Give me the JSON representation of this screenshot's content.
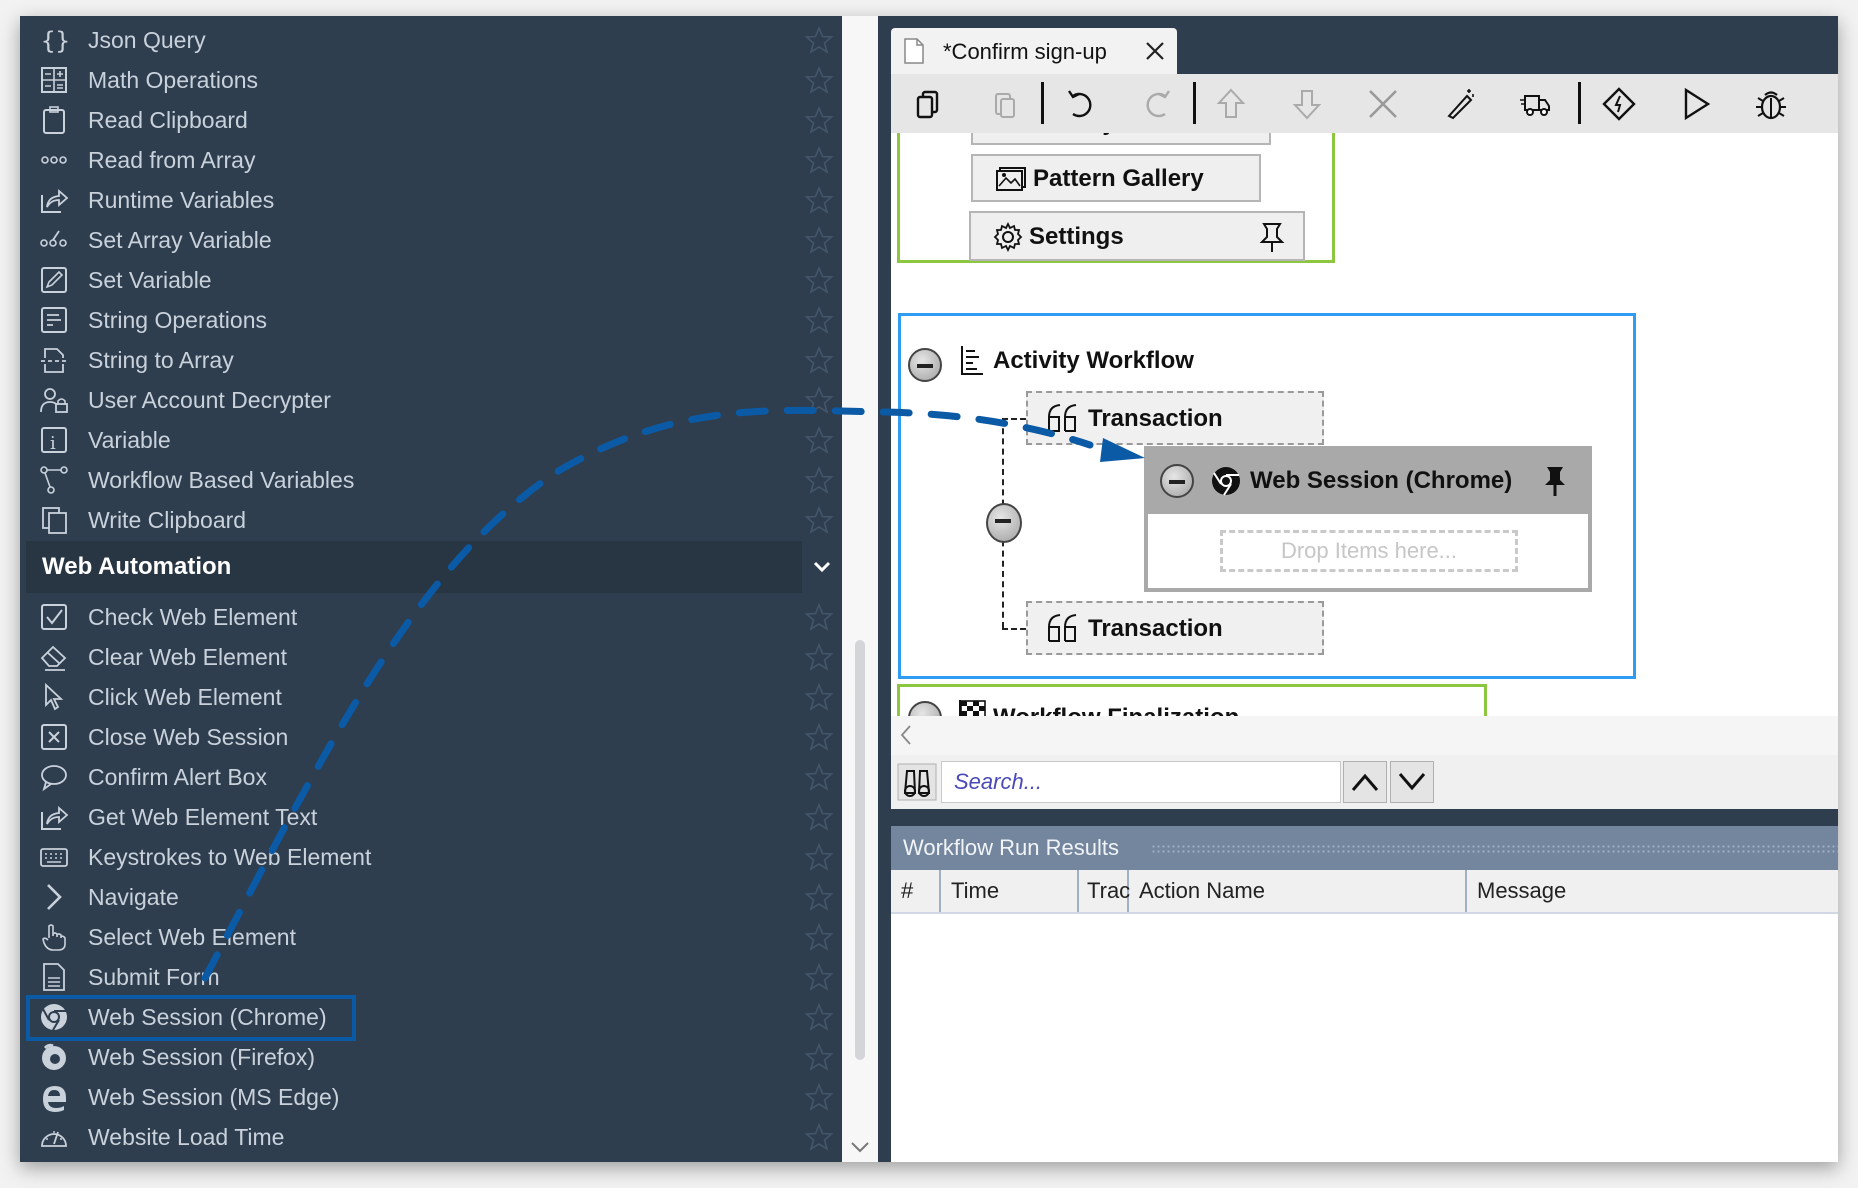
{
  "sidebar": {
    "items_top": [
      {
        "label": "Json Query",
        "icon": "braces-icon"
      },
      {
        "label": "Math Operations",
        "icon": "calculator-icon"
      },
      {
        "label": "Read Clipboard",
        "icon": "clipboard-icon"
      },
      {
        "label": "Read from Array",
        "icon": "array-dots-icon"
      },
      {
        "label": "Runtime Variables",
        "icon": "share-arrow-icon"
      },
      {
        "label": "Set Array Variable",
        "icon": "set-array-icon"
      },
      {
        "label": "Set Variable",
        "icon": "pencil-icon"
      },
      {
        "label": "String Operations",
        "icon": "text-lines-icon"
      },
      {
        "label": "String to Array",
        "icon": "string-to-array-icon"
      },
      {
        "label": "User Account Decrypter",
        "icon": "user-lock-icon"
      },
      {
        "label": "Variable",
        "icon": "info-icon"
      },
      {
        "label": "Workflow Based Variables",
        "icon": "flow-nodes-icon"
      },
      {
        "label": "Write Clipboard",
        "icon": "copy-clipboard-icon"
      }
    ],
    "section": {
      "title": "Web Automation",
      "expanded": true
    },
    "items_web": [
      {
        "label": "Check Web Element",
        "icon": "checkbox-icon"
      },
      {
        "label": "Clear Web Element",
        "icon": "eraser-icon"
      },
      {
        "label": "Click Web Element",
        "icon": "cursor-icon"
      },
      {
        "label": "Close Web Session",
        "icon": "close-box-icon"
      },
      {
        "label": "Confirm Alert Box",
        "icon": "speech-bubble-icon"
      },
      {
        "label": "Get Web Element Text",
        "icon": "share-arrow-icon"
      },
      {
        "label": "Keystrokes to Web Element",
        "icon": "keyboard-icon"
      },
      {
        "label": "Navigate",
        "icon": "chevron-right-icon"
      },
      {
        "label": "Select Web Element",
        "icon": "hand-pointer-icon"
      },
      {
        "label": "Submit Form",
        "icon": "form-icon"
      },
      {
        "label": "Web Session (Chrome)",
        "icon": "chrome-icon",
        "highlighted": true
      },
      {
        "label": "Web Session (Firefox)",
        "icon": "firefox-icon"
      },
      {
        "label": "Web Session (MS Edge)",
        "icon": "edge-icon"
      },
      {
        "label": "Website Load Time",
        "icon": "speedometer-icon"
      }
    ]
  },
  "editor": {
    "tab": {
      "title": "*Confirm sign-up",
      "close": "X"
    },
    "toolbar": [
      "copy",
      "paste",
      "undo",
      "redo",
      "move-up",
      "move-down",
      "delete",
      "magic-wand",
      "delivery-truck",
      "diamond-bolt",
      "run",
      "debug"
    ],
    "canvas": {
      "partial_item": "Activity Parameters",
      "pattern_gallery": "Pattern Gallery",
      "settings": "Settings",
      "activity_workflow": "Activity Workflow",
      "transaction_1": "Transaction",
      "transaction_2": "Transaction",
      "web_session": "Web Session (Chrome)",
      "drop_placeholder": "Drop Items here...",
      "workflow_finalization": "Workflow Finalization"
    },
    "search": {
      "placeholder": "Search..."
    }
  },
  "results": {
    "title": "Workflow Run Results",
    "columns": [
      "#",
      "Time",
      "Trac",
      "Action Name",
      "Message"
    ],
    "rows": []
  },
  "colors": {
    "sidebar_bg": "#2e3e4f",
    "accent_blue": "#0a5aa6",
    "green_border": "#8dc63f",
    "workflow_blue_border": "#2e9cf0"
  }
}
